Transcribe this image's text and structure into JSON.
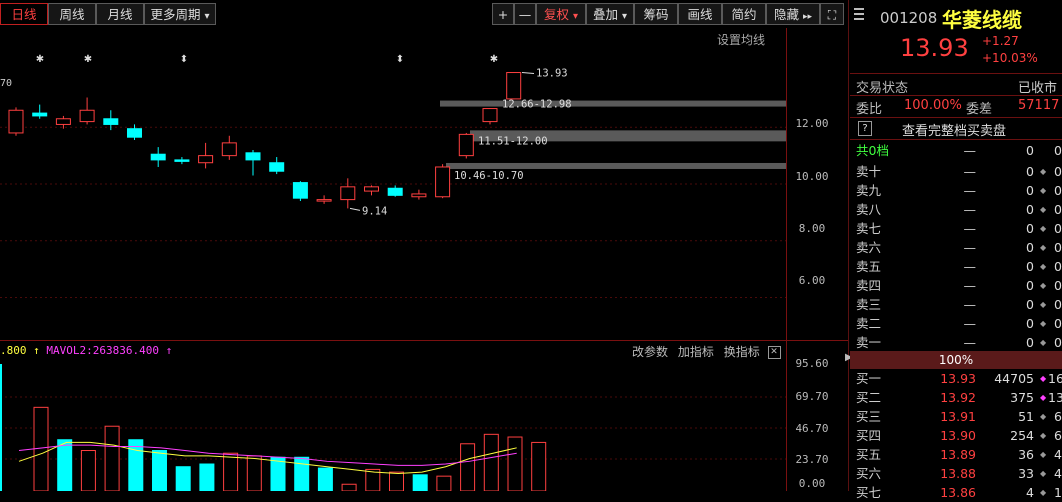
{
  "toolbar": {
    "period_tabs": [
      "日线",
      "周线",
      "月线",
      "更多周期"
    ],
    "more_arrow": "▾",
    "right_buttons": [
      "+",
      "—",
      "复权",
      "叠加",
      "筹码",
      "画线",
      "简约",
      "隐藏"
    ],
    "fuquan_arrow": "▾",
    "diejia_arrow": "▾",
    "collapse_glyph": "▸▸",
    "expand_glyph": "⛶"
  },
  "chart": {
    "settings_link": "设置均线",
    "partial_left_label": "70",
    "price_axis": [
      "12.00",
      "10.00",
      "8.00",
      "6.00"
    ],
    "annotations": {
      "high": "13.93",
      "low": "9.14"
    },
    "chip_bands": [
      "12.66-12.98",
      "11.51-12.00",
      "10.46-10.70"
    ],
    "markers": [
      "✱",
      "✱",
      "⬍",
      "⬍",
      "✱"
    ]
  },
  "volume": {
    "legend_left": ".800",
    "legend_mavol2": "MAVOL2:263836.400",
    "arrow_up": "↑",
    "buttons": [
      "改参数",
      "加指标",
      "换指标"
    ],
    "axis": [
      "95.60",
      "69.70",
      "46.70",
      "23.70",
      "0.00"
    ]
  },
  "chart_data": {
    "type": "candlestick",
    "candles": [
      {
        "o": 11.8,
        "c": 12.6,
        "h": 12.7,
        "l": 11.7
      },
      {
        "o": 12.5,
        "c": 12.4,
        "h": 12.8,
        "l": 12.3
      },
      {
        "o": 12.1,
        "c": 12.3,
        "h": 12.4,
        "l": 11.95
      },
      {
        "o": 12.2,
        "c": 12.6,
        "h": 13.05,
        "l": 12.1
      },
      {
        "o": 12.3,
        "c": 12.1,
        "h": 12.6,
        "l": 11.9
      },
      {
        "o": 11.95,
        "c": 11.65,
        "h": 12.1,
        "l": 11.55
      },
      {
        "o": 11.05,
        "c": 10.85,
        "h": 11.3,
        "l": 10.6
      },
      {
        "o": 10.85,
        "c": 10.8,
        "h": 10.95,
        "l": 10.7
      },
      {
        "o": 10.75,
        "c": 11.0,
        "h": 11.45,
        "l": 10.55
      },
      {
        "o": 11.0,
        "c": 11.45,
        "h": 11.7,
        "l": 10.85
      },
      {
        "o": 11.1,
        "c": 10.85,
        "h": 11.2,
        "l": 10.3
      },
      {
        "o": 10.75,
        "c": 10.45,
        "h": 10.95,
        "l": 10.35
      },
      {
        "o": 10.05,
        "c": 9.5,
        "h": 10.1,
        "l": 9.4
      },
      {
        "o": 9.4,
        "c": 9.45,
        "h": 9.6,
        "l": 9.3
      },
      {
        "o": 9.45,
        "c": 9.9,
        "h": 10.2,
        "l": 9.14
      },
      {
        "o": 9.75,
        "c": 9.9,
        "h": 9.95,
        "l": 9.6
      },
      {
        "o": 9.85,
        "c": 9.6,
        "h": 9.95,
        "l": 9.55
      },
      {
        "o": 9.55,
        "c": 9.65,
        "h": 9.8,
        "l": 9.45
      },
      {
        "o": 9.55,
        "c": 10.6,
        "h": 10.7,
        "l": 9.5
      },
      {
        "o": 11.0,
        "c": 11.75,
        "h": 11.8,
        "l": 10.9
      },
      {
        "o": 12.2,
        "c": 12.66,
        "h": 12.66,
        "l": 12.1
      },
      {
        "o": 13.0,
        "c": 13.93,
        "h": 13.93,
        "l": 12.98
      }
    ],
    "volumes": [
      62,
      38,
      30,
      48,
      38,
      30,
      18,
      20,
      28,
      26,
      25,
      25,
      17,
      5,
      16,
      14,
      12,
      11,
      35,
      42,
      40,
      36
    ],
    "ma1": [
      22,
      28,
      36,
      36,
      34,
      30,
      28,
      26,
      26,
      25,
      24,
      22,
      20,
      18,
      16,
      14,
      13,
      14,
      18,
      24,
      28,
      32
    ],
    "ma2": [
      30,
      32,
      34,
      34,
      33,
      33,
      32,
      30,
      28,
      27,
      26,
      25,
      24,
      22,
      21,
      20,
      19,
      19,
      20,
      22,
      25,
      28
    ],
    "ylim": [
      4.5,
      15.5
    ],
    "vol_ylim": [
      0,
      95.6
    ]
  },
  "quote": {
    "code": "001208",
    "name": "华菱线缆",
    "price": "13.93",
    "change": "+1.27",
    "change_pct": "+10.03%",
    "status_label": "交易状态",
    "status_value": "已收市",
    "ratio_label": "委比",
    "ratio_value": "100.00%",
    "diff_label": "委差",
    "diff_value": "57117",
    "help": "?",
    "full_depth": "查看完整档买卖盘",
    "total_levels": "共0档",
    "dash": "—",
    "zero": "0",
    "diamond": "◆",
    "percent_bar": "100%",
    "asks": [
      "卖十",
      "卖九",
      "卖八",
      "卖七",
      "卖六",
      "卖五",
      "卖四",
      "卖三",
      "卖二",
      "卖一"
    ],
    "bids": [
      {
        "label": "买一",
        "price": "13.93",
        "vol": "44705",
        "x": "16"
      },
      {
        "label": "买二",
        "price": "13.92",
        "vol": "375",
        "x": "13"
      },
      {
        "label": "买三",
        "price": "13.91",
        "vol": "51",
        "x": "6"
      },
      {
        "label": "买四",
        "price": "13.90",
        "vol": "254",
        "x": "6"
      },
      {
        "label": "买五",
        "price": "13.89",
        "vol": "36",
        "x": "4"
      },
      {
        "label": "买六",
        "price": "13.88",
        "vol": "33",
        "x": "4"
      },
      {
        "label": "买七",
        "price": "13.86",
        "vol": "4",
        "x": "1"
      }
    ]
  },
  "colors": {
    "up": "#ff4040",
    "down": "#00ffff",
    "ma1": "#ffff40",
    "ma2": "#ff40ff",
    "grid": "#4a0a0a"
  }
}
